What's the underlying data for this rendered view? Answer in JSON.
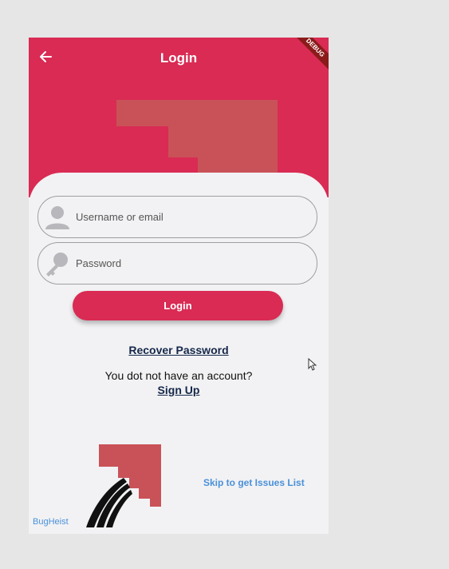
{
  "header": {
    "title": "Login",
    "debug_banner": "DEBUG",
    "background_color": "#d92b53",
    "back_icon": "arrow-left-icon"
  },
  "form": {
    "username": {
      "placeholder": "Username or email",
      "value": "",
      "icon": "person-icon"
    },
    "password": {
      "placeholder": "Password",
      "value": "",
      "icon": "key-icon"
    },
    "login_label": "Login"
  },
  "links": {
    "recover": "Recover Password",
    "no_account": "You dot not have an account?",
    "sign_up": "Sign Up",
    "skip": "Skip to get Issues List"
  },
  "footer": {
    "brand": "BugHeist"
  },
  "colors": {
    "accent": "#d92b53",
    "link_dark": "#15284a",
    "link_blue": "#4a90d9",
    "background": "#f2f2f4"
  }
}
